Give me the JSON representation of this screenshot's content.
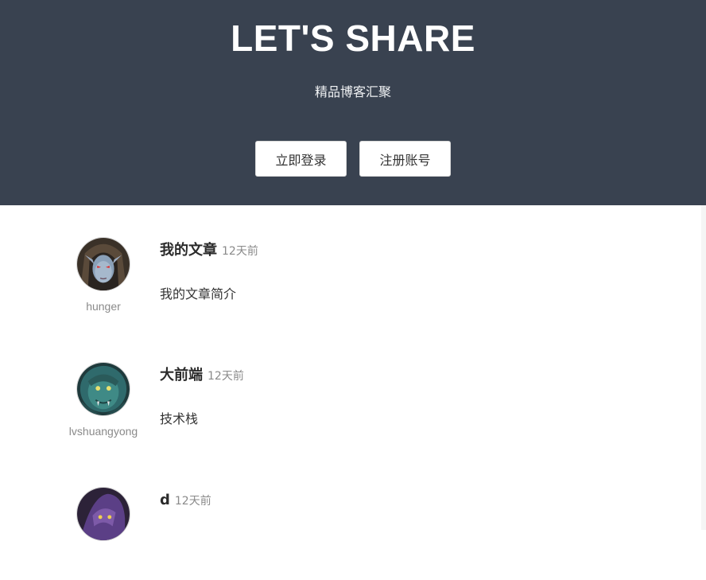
{
  "hero": {
    "title": "LET'S SHARE",
    "subtitle": "精品博客汇聚",
    "login_label": "立即登录",
    "register_label": "注册账号"
  },
  "posts": [
    {
      "author": "hunger",
      "avatar_icon": "hooded-elf-avatar",
      "title": "我的文章",
      "time": "12天前",
      "summary": "我的文章简介"
    },
    {
      "author": "lvshuangyong",
      "avatar_icon": "green-orc-avatar",
      "title": "大前端",
      "time": "12天前",
      "summary": "技术栈"
    },
    {
      "author": "",
      "avatar_icon": "purple-creature-avatar",
      "title": "d",
      "time": "12天前",
      "summary": ""
    }
  ],
  "colors": {
    "hero_bg": "#394250",
    "text_dark": "#2b2b2b",
    "text_muted": "#8a8a8a"
  }
}
